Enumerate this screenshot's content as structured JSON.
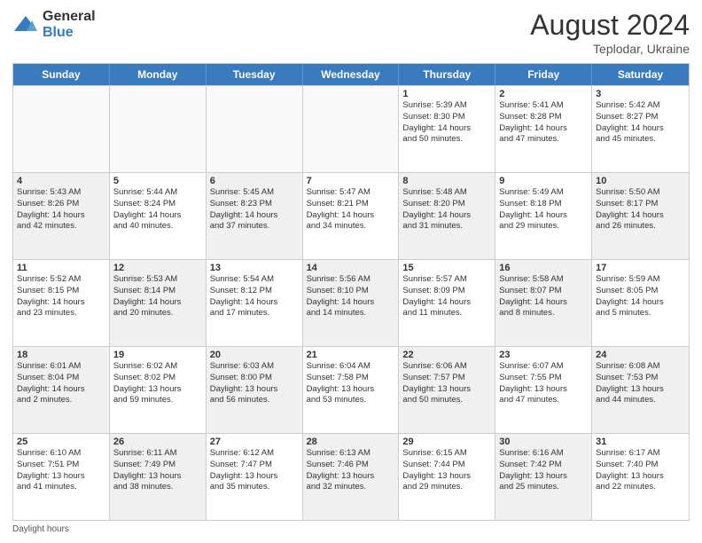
{
  "logo": {
    "general": "General",
    "blue": "Blue"
  },
  "title": "August 2024",
  "location": "Teplodar, Ukraine",
  "footer": "Daylight hours",
  "headers": [
    "Sunday",
    "Monday",
    "Tuesday",
    "Wednesday",
    "Thursday",
    "Friday",
    "Saturday"
  ],
  "weeks": [
    [
      {
        "day": "",
        "lines": [],
        "empty": true
      },
      {
        "day": "",
        "lines": [],
        "empty": true
      },
      {
        "day": "",
        "lines": [],
        "empty": true
      },
      {
        "day": "",
        "lines": [],
        "empty": true
      },
      {
        "day": "1",
        "lines": [
          "Sunrise: 5:39 AM",
          "Sunset: 8:30 PM",
          "Daylight: 14 hours",
          "and 50 minutes."
        ]
      },
      {
        "day": "2",
        "lines": [
          "Sunrise: 5:41 AM",
          "Sunset: 8:28 PM",
          "Daylight: 14 hours",
          "and 47 minutes."
        ]
      },
      {
        "day": "3",
        "lines": [
          "Sunrise: 5:42 AM",
          "Sunset: 8:27 PM",
          "Daylight: 14 hours",
          "and 45 minutes."
        ]
      }
    ],
    [
      {
        "day": "4",
        "lines": [
          "Sunrise: 5:43 AM",
          "Sunset: 8:26 PM",
          "Daylight: 14 hours",
          "and 42 minutes."
        ],
        "shaded": true
      },
      {
        "day": "5",
        "lines": [
          "Sunrise: 5:44 AM",
          "Sunset: 8:24 PM",
          "Daylight: 14 hours",
          "and 40 minutes."
        ]
      },
      {
        "day": "6",
        "lines": [
          "Sunrise: 5:45 AM",
          "Sunset: 8:23 PM",
          "Daylight: 14 hours",
          "and 37 minutes."
        ],
        "shaded": true
      },
      {
        "day": "7",
        "lines": [
          "Sunrise: 5:47 AM",
          "Sunset: 8:21 PM",
          "Daylight: 14 hours",
          "and 34 minutes."
        ]
      },
      {
        "day": "8",
        "lines": [
          "Sunrise: 5:48 AM",
          "Sunset: 8:20 PM",
          "Daylight: 14 hours",
          "and 31 minutes."
        ],
        "shaded": true
      },
      {
        "day": "9",
        "lines": [
          "Sunrise: 5:49 AM",
          "Sunset: 8:18 PM",
          "Daylight: 14 hours",
          "and 29 minutes."
        ]
      },
      {
        "day": "10",
        "lines": [
          "Sunrise: 5:50 AM",
          "Sunset: 8:17 PM",
          "Daylight: 14 hours",
          "and 26 minutes."
        ],
        "shaded": true
      }
    ],
    [
      {
        "day": "11",
        "lines": [
          "Sunrise: 5:52 AM",
          "Sunset: 8:15 PM",
          "Daylight: 14 hours",
          "and 23 minutes."
        ]
      },
      {
        "day": "12",
        "lines": [
          "Sunrise: 5:53 AM",
          "Sunset: 8:14 PM",
          "Daylight: 14 hours",
          "and 20 minutes."
        ],
        "shaded": true
      },
      {
        "day": "13",
        "lines": [
          "Sunrise: 5:54 AM",
          "Sunset: 8:12 PM",
          "Daylight: 14 hours",
          "and 17 minutes."
        ]
      },
      {
        "day": "14",
        "lines": [
          "Sunrise: 5:56 AM",
          "Sunset: 8:10 PM",
          "Daylight: 14 hours",
          "and 14 minutes."
        ],
        "shaded": true
      },
      {
        "day": "15",
        "lines": [
          "Sunrise: 5:57 AM",
          "Sunset: 8:09 PM",
          "Daylight: 14 hours",
          "and 11 minutes."
        ]
      },
      {
        "day": "16",
        "lines": [
          "Sunrise: 5:58 AM",
          "Sunset: 8:07 PM",
          "Daylight: 14 hours",
          "and 8 minutes."
        ],
        "shaded": true
      },
      {
        "day": "17",
        "lines": [
          "Sunrise: 5:59 AM",
          "Sunset: 8:05 PM",
          "Daylight: 14 hours",
          "and 5 minutes."
        ]
      }
    ],
    [
      {
        "day": "18",
        "lines": [
          "Sunrise: 6:01 AM",
          "Sunset: 8:04 PM",
          "Daylight: 14 hours",
          "and 2 minutes."
        ],
        "shaded": true
      },
      {
        "day": "19",
        "lines": [
          "Sunrise: 6:02 AM",
          "Sunset: 8:02 PM",
          "Daylight: 13 hours",
          "and 59 minutes."
        ]
      },
      {
        "day": "20",
        "lines": [
          "Sunrise: 6:03 AM",
          "Sunset: 8:00 PM",
          "Daylight: 13 hours",
          "and 56 minutes."
        ],
        "shaded": true
      },
      {
        "day": "21",
        "lines": [
          "Sunrise: 6:04 AM",
          "Sunset: 7:58 PM",
          "Daylight: 13 hours",
          "and 53 minutes."
        ]
      },
      {
        "day": "22",
        "lines": [
          "Sunrise: 6:06 AM",
          "Sunset: 7:57 PM",
          "Daylight: 13 hours",
          "and 50 minutes."
        ],
        "shaded": true
      },
      {
        "day": "23",
        "lines": [
          "Sunrise: 6:07 AM",
          "Sunset: 7:55 PM",
          "Daylight: 13 hours",
          "and 47 minutes."
        ]
      },
      {
        "day": "24",
        "lines": [
          "Sunrise: 6:08 AM",
          "Sunset: 7:53 PM",
          "Daylight: 13 hours",
          "and 44 minutes."
        ],
        "shaded": true
      }
    ],
    [
      {
        "day": "25",
        "lines": [
          "Sunrise: 6:10 AM",
          "Sunset: 7:51 PM",
          "Daylight: 13 hours",
          "and 41 minutes."
        ]
      },
      {
        "day": "26",
        "lines": [
          "Sunrise: 6:11 AM",
          "Sunset: 7:49 PM",
          "Daylight: 13 hours",
          "and 38 minutes."
        ],
        "shaded": true
      },
      {
        "day": "27",
        "lines": [
          "Sunrise: 6:12 AM",
          "Sunset: 7:47 PM",
          "Daylight: 13 hours",
          "and 35 minutes."
        ]
      },
      {
        "day": "28",
        "lines": [
          "Sunrise: 6:13 AM",
          "Sunset: 7:46 PM",
          "Daylight: 13 hours",
          "and 32 minutes."
        ],
        "shaded": true
      },
      {
        "day": "29",
        "lines": [
          "Sunrise: 6:15 AM",
          "Sunset: 7:44 PM",
          "Daylight: 13 hours",
          "and 29 minutes."
        ]
      },
      {
        "day": "30",
        "lines": [
          "Sunrise: 6:16 AM",
          "Sunset: 7:42 PM",
          "Daylight: 13 hours",
          "and 25 minutes."
        ],
        "shaded": true
      },
      {
        "day": "31",
        "lines": [
          "Sunrise: 6:17 AM",
          "Sunset: 7:40 PM",
          "Daylight: 13 hours",
          "and 22 minutes."
        ]
      }
    ]
  ]
}
